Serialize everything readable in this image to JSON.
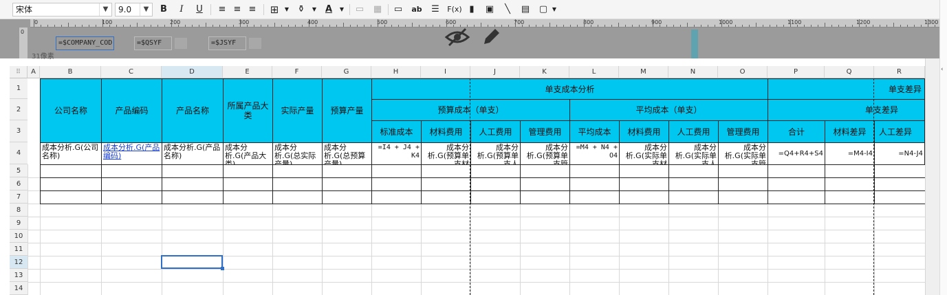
{
  "toolbar": {
    "font_name": "宋体",
    "font_size": "9.0",
    "bold": "B",
    "italic": "I",
    "underline": "U",
    "text_ab": "ab",
    "formula": "F(x)"
  },
  "ruler": {
    "numbers": [
      "0",
      "100",
      "200",
      "300",
      "400",
      "500",
      "600",
      "700",
      "800",
      "900",
      "1000",
      "1100",
      "1200",
      "1300"
    ],
    "vertical_zero": "0",
    "fields": [
      "=$COMPANY_COD",
      "=$QSYF",
      "=$JSYF"
    ],
    "watermark": "31像素"
  },
  "columns": [
    "A",
    "B",
    "C",
    "D",
    "E",
    "F",
    "G",
    "H",
    "I",
    "J",
    "K",
    "L",
    "M",
    "N",
    "O",
    "P",
    "Q",
    "R"
  ],
  "rows": [
    "1",
    "2",
    "3",
    "4",
    "5",
    "6",
    "7",
    "8",
    "9",
    "10",
    "11",
    "12",
    "13",
    "14"
  ],
  "header": {
    "company": "公司名称",
    "product_code": "产品编码",
    "product_name": "产品名称",
    "category": "所属产品大类",
    "actual_output": "实际产量",
    "budget_output": "预算产量",
    "unit_cost_analysis": "单支成本分析",
    "unit_diff_top": "单支差异",
    "budget_cost": "预算成本（单支）",
    "avg_cost": "平均成本（单支）",
    "unit_diff": "单支差异",
    "row3": [
      "标准成本",
      "材料费用",
      "人工费用",
      "管理费用",
      "平均成本",
      "材料费用",
      "人工费用",
      "管理费用",
      "合计",
      "材料差异",
      "人工差异"
    ]
  },
  "data_row": {
    "b": "成本分析.G(公司名称)",
    "c": "成本分析.G(产品编码)",
    "d": "成本分析.G(产品名称)",
    "e": "成本分析.G(产品大类)",
    "f": "成本分析.G(总实际产量)",
    "g": "成本分析.G(总预算产量)",
    "h": "=I4 + J4 + K4",
    "i": "成本分析.G(预算单支材",
    "j": "成本分析.G(预算单支人",
    "k": "成本分析.G(预算单支管",
    "l": "=M4 + N4 + O4",
    "m": "成本分析.G(实际单支材",
    "n": "成本分析.G(实际单支人",
    "o": "成本分析.G(实际单支管",
    "p": "=Q4+R4+S4",
    "q": "=M4-I4",
    "r": "=N4-J4"
  }
}
